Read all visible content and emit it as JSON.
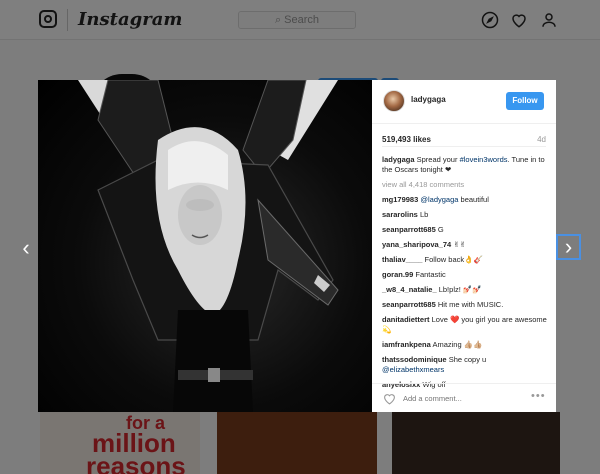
{
  "header": {
    "wordmark": "Instagram",
    "search_placeholder": "Search"
  },
  "background": {
    "tile_text": [
      "for a",
      "million",
      "reasons"
    ]
  },
  "post": {
    "username": "ladygaga",
    "follow_label": "Follow",
    "likes": "519,493 likes",
    "time": "4d",
    "caption_user": "ladygaga",
    "caption_pre": "Spread your ",
    "caption_tag": "#lovein3words",
    "caption_post": ". Tune in to the Oscars tonight ❤",
    "view_all": "view all 4,418 comments",
    "comments": [
      {
        "user": "mg179983",
        "mention": "@ladygaga",
        "text": " beautiful"
      },
      {
        "user": "sararolins",
        "text": "Lb"
      },
      {
        "user": "seanparrott685",
        "text": "G"
      },
      {
        "user": "yana_sharipova_74",
        "text": "✌✌"
      },
      {
        "user": "thaliav____",
        "text": "Follow back👌🎸"
      },
      {
        "user": "goran.99",
        "text": "Fantastic"
      },
      {
        "user": "_w8_4_natalie_",
        "text": "Lb!plz! 💅🏻💅🏻"
      },
      {
        "user": "seanparrott685",
        "text": "Hit me with MUSIC."
      },
      {
        "user": "danitadiettert",
        "text": "Love ❤️ you girl you are awesome 💫"
      },
      {
        "user": "iamfrankpena",
        "text": "Amazing 👍🏼👍🏼"
      },
      {
        "user": "thatssodominique",
        "text": "She copy u ",
        "mention": "@elizabethxmears"
      },
      {
        "user": "anyelosixx",
        "text": "Wig off"
      }
    ],
    "add_comment_placeholder": "Add a comment...",
    "more": "•••"
  },
  "nav": {
    "prev": "‹",
    "next": "›"
  },
  "colors": {
    "accent": "#3897f0",
    "link": "#003569",
    "overlay": "rgba(0,0,0,0.5)"
  }
}
